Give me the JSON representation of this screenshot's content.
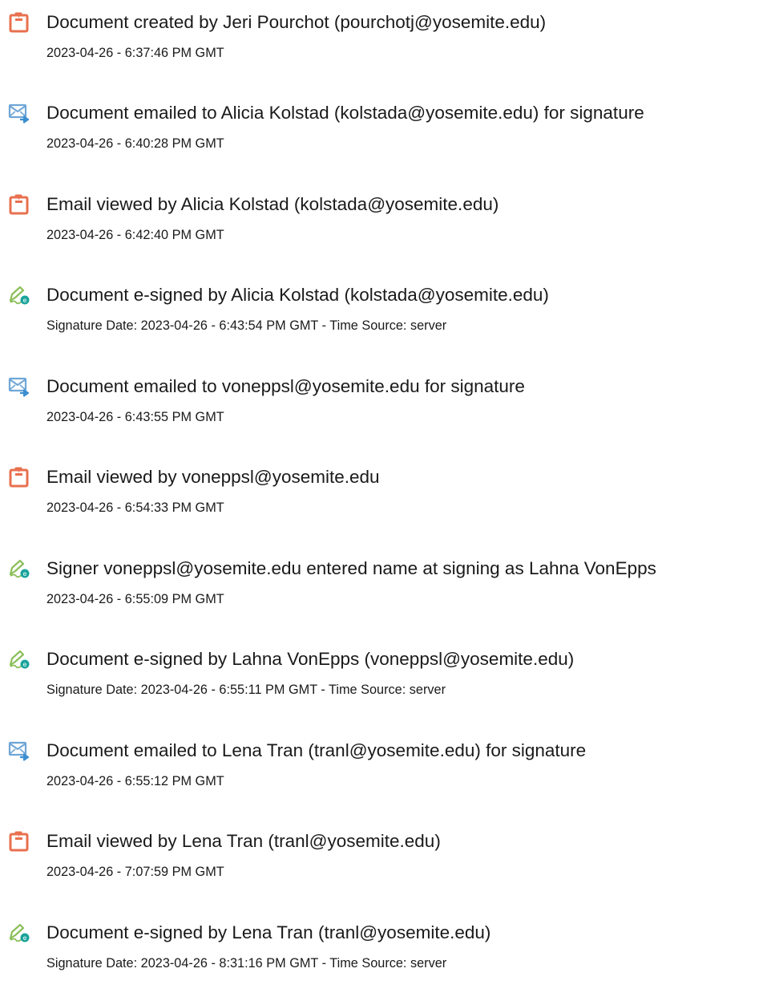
{
  "audit_events": [
    {
      "icon": "document-created-icon",
      "title": "Document created by Jeri Pourchot (pourchotj@yosemite.edu)",
      "detail": "2023-04-26 - 6:37:46 PM GMT"
    },
    {
      "icon": "document-emailed-icon",
      "title": "Document emailed to Alicia Kolstad (kolstada@yosemite.edu) for signature",
      "detail": "2023-04-26 - 6:40:28 PM GMT"
    },
    {
      "icon": "email-viewed-icon",
      "title": "Email viewed by Alicia Kolstad (kolstada@yosemite.edu)",
      "detail": "2023-04-26 - 6:42:40 PM GMT"
    },
    {
      "icon": "e-signed-icon",
      "title": "Document e-signed by Alicia Kolstad (kolstada@yosemite.edu)",
      "detail": "Signature Date: 2023-04-26 - 6:43:54 PM GMT - Time Source: server"
    },
    {
      "icon": "document-emailed-icon",
      "title": "Document emailed to voneppsl@yosemite.edu for signature",
      "detail": "2023-04-26 - 6:43:55 PM GMT"
    },
    {
      "icon": "email-viewed-icon",
      "title": "Email viewed by voneppsl@yosemite.edu",
      "detail": "2023-04-26 - 6:54:33 PM GMT"
    },
    {
      "icon": "e-signed-icon",
      "title": "Signer voneppsl@yosemite.edu entered name at signing as Lahna VonEpps",
      "detail": "2023-04-26 - 6:55:09 PM GMT"
    },
    {
      "icon": "e-signed-icon",
      "title": "Document e-signed by Lahna VonEpps (voneppsl@yosemite.edu)",
      "detail": "Signature Date: 2023-04-26 - 6:55:11 PM GMT - Time Source: server"
    },
    {
      "icon": "document-emailed-icon",
      "title": "Document emailed to Lena Tran (tranl@yosemite.edu) for signature",
      "detail": "2023-04-26 - 6:55:12 PM GMT"
    },
    {
      "icon": "email-viewed-icon",
      "title": "Email viewed by Lena Tran (tranl@yosemite.edu)",
      "detail": "2023-04-26 - 7:07:59 PM GMT"
    },
    {
      "icon": "e-signed-icon",
      "title": "Document e-signed by Lena Tran (tranl@yosemite.edu)",
      "detail": "Signature Date: 2023-04-26 - 8:31:16 PM GMT - Time Source: server"
    }
  ],
  "colors": {
    "document_icon": "#e8704f",
    "email_icon": "#6fa6d6",
    "signature_icon_pen": "#8bbf5a",
    "signature_icon_badge": "#1aa39b",
    "text": "#1a1a1a"
  }
}
